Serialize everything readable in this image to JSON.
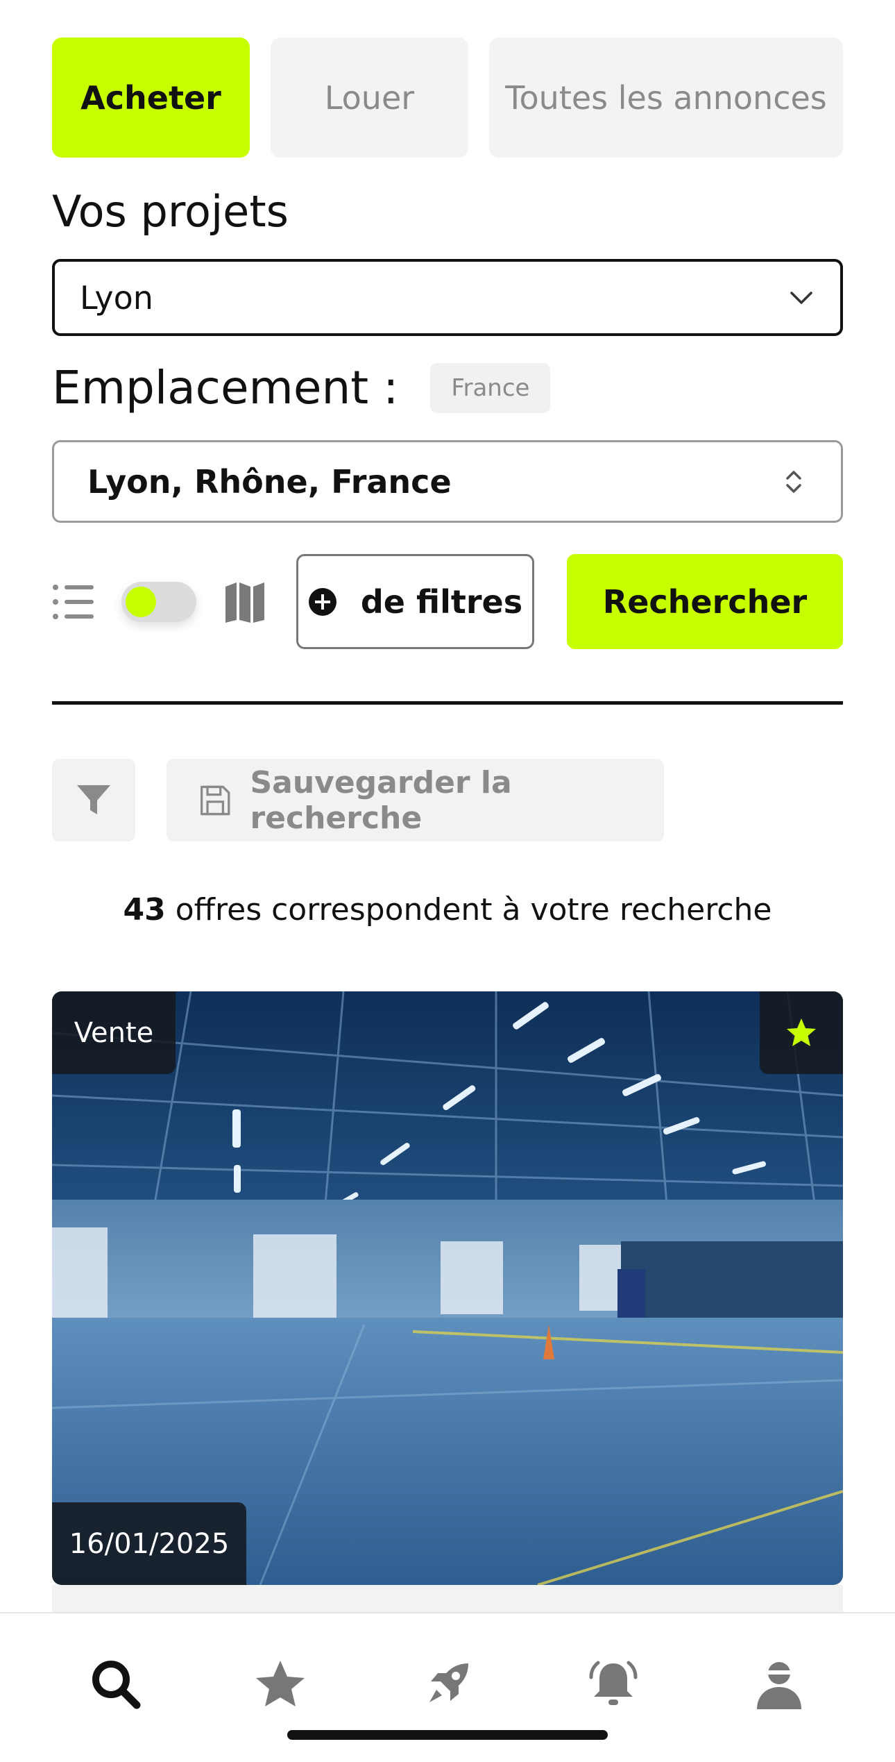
{
  "tabs": [
    {
      "label": "Acheter",
      "active": true
    },
    {
      "label": "Louer",
      "active": false
    },
    {
      "label": "Toutes les annonces",
      "active": false
    }
  ],
  "projects": {
    "title": "Vos projets",
    "selected": "Lyon"
  },
  "location": {
    "title": "Emplacement :",
    "country_chip": "France",
    "selected": "Lyon, Rhône, France"
  },
  "controls": {
    "view_toggle_on": true,
    "filters_label": "de filtres",
    "search_label": "Rechercher"
  },
  "save_search": {
    "label": "Sauvegarder la recherche"
  },
  "results": {
    "count": "43",
    "text": "offres correspondent à votre recherche"
  },
  "listing": {
    "type_badge": "Vente",
    "date": "16/01/2025",
    "favorited": true
  },
  "colors": {
    "accent": "#c8ff00",
    "dark": "#111111",
    "muted": "#8a8a8a",
    "surface": "#f3f3f3"
  },
  "nav": {
    "items": [
      {
        "icon": "search-icon",
        "active": true
      },
      {
        "icon": "star-icon",
        "active": false
      },
      {
        "icon": "rocket-icon",
        "active": false
      },
      {
        "icon": "bell-icon",
        "active": false
      },
      {
        "icon": "user-icon",
        "active": false
      }
    ]
  }
}
